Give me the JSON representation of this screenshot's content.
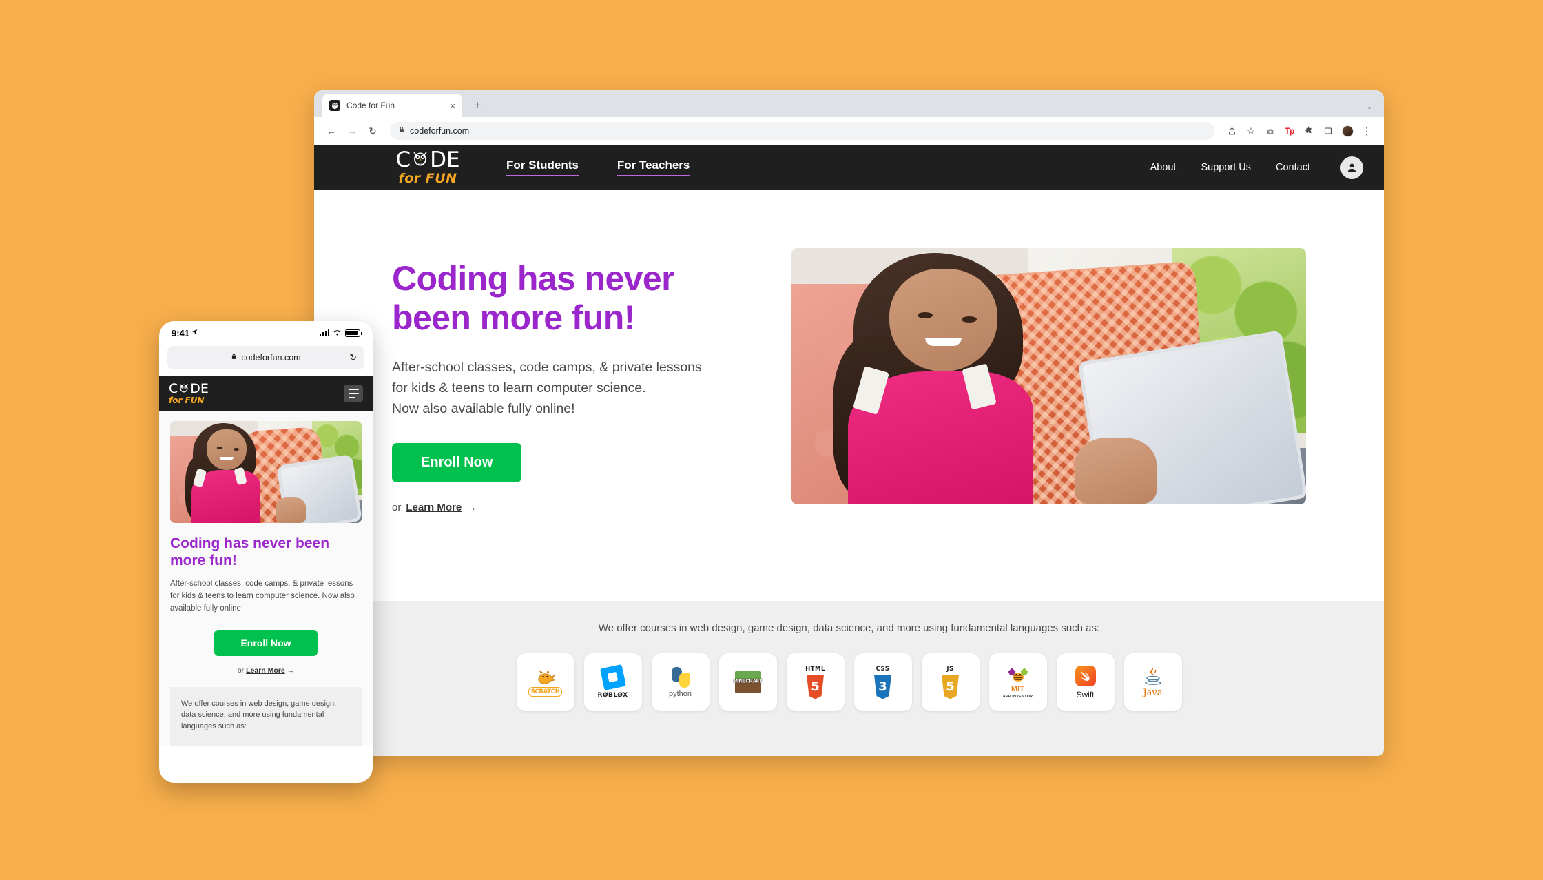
{
  "browser": {
    "tab": {
      "title": "Code for Fun",
      "favicon": "owl-favicon",
      "close": "×"
    },
    "new_tab": "+",
    "tabstrip_chevron": "⌄",
    "nav": {
      "back": "←",
      "forward": "→",
      "reload": "↻"
    },
    "omnibox": {
      "lock": "🔒",
      "url": "codeforfun.com"
    },
    "toolbar_icons": {
      "share": "⤴",
      "bookmark": "☆",
      "camera": "📷",
      "extension_tp": "Tp",
      "puzzle": "✦",
      "sidebar": "□",
      "menu": "⋮"
    }
  },
  "site": {
    "logo": {
      "word_before": "C",
      "word_after": "DE",
      "tagline": "for FUN",
      "mark": "owl-icon"
    },
    "nav_main": [
      {
        "label": "For Students",
        "name": "nav-for-students"
      },
      {
        "label": "For Teachers",
        "name": "nav-for-teachers"
      }
    ],
    "nav_right": [
      {
        "label": "About",
        "name": "nav-about"
      },
      {
        "label": "Support Us",
        "name": "nav-support-us"
      },
      {
        "label": "Contact",
        "name": "nav-contact"
      }
    ],
    "account_icon": "user-avatar-icon",
    "hero": {
      "title": "Coding has never been more fun!",
      "subtitle_line1": "After-school classes, code camps, & private lessons",
      "subtitle_line2": "for kids & teens to learn computer science.",
      "subtitle_line3": "Now also available fully online!",
      "cta_label": "Enroll Now",
      "or_text": "or",
      "learn_more": "Learn More",
      "arrow": "→",
      "image_alt": "girl-with-tablet-photo"
    },
    "strip": {
      "text": "We offer courses in web design, game design, data science, and more using fundamental languages such as:",
      "logos": [
        {
          "name": "scratch",
          "label": "SCRATCH"
        },
        {
          "name": "roblox",
          "label": "RØBLØX"
        },
        {
          "name": "python",
          "label": "python"
        },
        {
          "name": "minecraft",
          "label": "MINECRAFT"
        },
        {
          "name": "html5",
          "label": "HTML",
          "mark": "5",
          "color": "#E44D26"
        },
        {
          "name": "css3",
          "label": "CSS",
          "mark": "3",
          "color": "#1B73BA"
        },
        {
          "name": "javascript",
          "label": "JS",
          "mark": "5",
          "color": "#E8A723"
        },
        {
          "name": "mit-app-inventor",
          "label": "MIT",
          "sub": "APP INVENTOR"
        },
        {
          "name": "swift",
          "label": "Swift"
        },
        {
          "name": "java",
          "label": "Java"
        }
      ]
    }
  },
  "phone": {
    "status": {
      "time": "9:41",
      "location_arrow": "➤",
      "signal": "signal-icon",
      "wifi": "▾",
      "battery": "battery-icon"
    },
    "urlbar": {
      "lock": "🔒",
      "url": "codeforfun.com",
      "reload": "↻"
    },
    "logo": {
      "word_before": "C",
      "word_after": "DE",
      "tagline": "for FUN"
    },
    "menu_icon": "hamburger-menu-icon",
    "hero": {
      "title": "Coding has never been more fun!",
      "subtitle": "After-school classes, code camps, & private lessons for kids & teens to learn computer science. Now also available fully online!",
      "cta_label": "Enroll Now",
      "or_text": "or",
      "learn_more": "Learn More",
      "arrow": "→"
    },
    "strip_text": "We offer courses in web design, game design, data science, and more using fundamental languages such as:"
  },
  "colors": {
    "page_background": "#F8AE4B",
    "header_dark": "#1F1F1F",
    "accent_purple": "#9B27CC",
    "nav_underline": "#B96BE0",
    "cta_green": "#00C14D",
    "logo_orange": "#F5A623",
    "strip_gray": "#EFEFEF"
  }
}
